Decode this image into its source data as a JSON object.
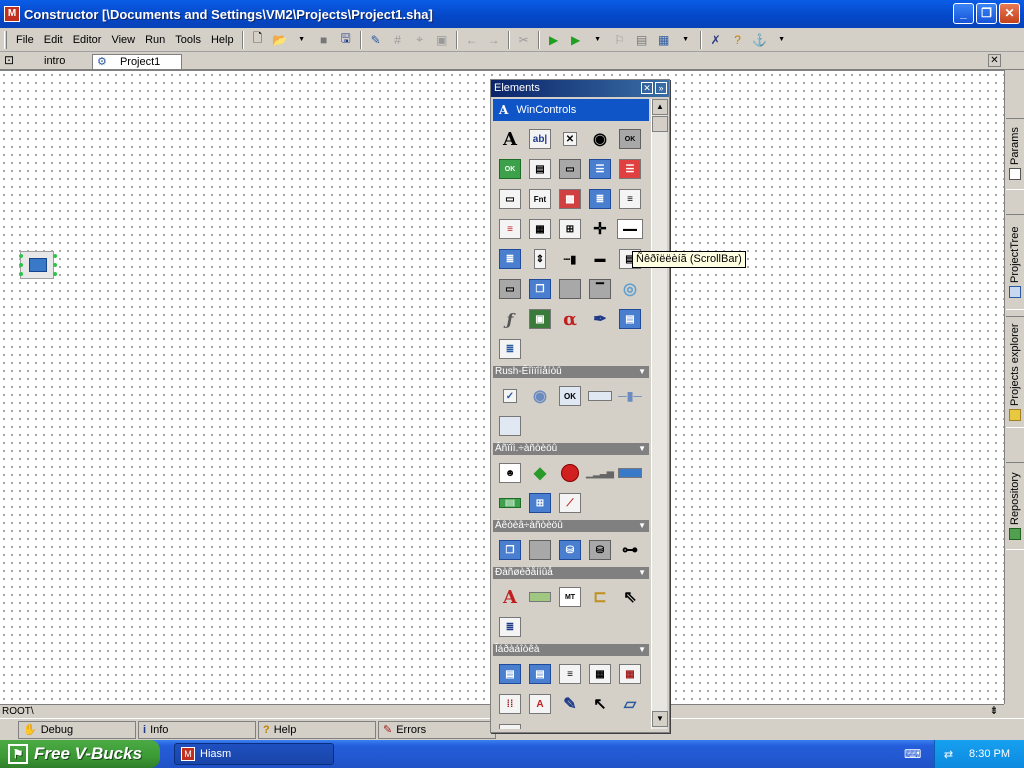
{
  "window": {
    "title": "Constructor [\\Documents and Settings\\VM2\\Projects\\Project1.sha]",
    "app_icon_glyph": "M"
  },
  "menu": [
    "File",
    "Edit",
    "Editor",
    "View",
    "Run",
    "Tools",
    "Help"
  ],
  "tabs": [
    {
      "label": "intro"
    },
    {
      "label": "Project1"
    }
  ],
  "palette": {
    "title": "Elements",
    "group": "WinControls",
    "categories": [
      {
        "label": "Rush-Êîìïîíåíòû"
      },
      {
        "label": "Âñïîì.÷àñòèöû"
      },
      {
        "label": "Àêòèâ÷àñòèöû"
      },
      {
        "label": "Ðàñøèðåííûå"
      },
      {
        "label": "Îáðàáîòêà"
      }
    ],
    "tooltip": "Ñêðîëëèíã (ScrollBar)"
  },
  "sidebar": [
    "Params",
    "ProjectTree",
    "Projects explorer",
    "Repository"
  ],
  "status": {
    "path": "ROOT\\"
  },
  "bottom_tabs": [
    "Debug",
    "Info",
    "Help",
    "Errors"
  ],
  "taskbar": {
    "start_label": "Free V-Bucks",
    "task_label": "Hiasm",
    "clock": "8:30 PM"
  },
  "colors": {
    "titlebar": "#0a5ce6",
    "start": "#3c9a35",
    "taskbar": "#245edb",
    "palette_header": "#0f55c8",
    "tooltip_bg": "#ffffe1"
  }
}
